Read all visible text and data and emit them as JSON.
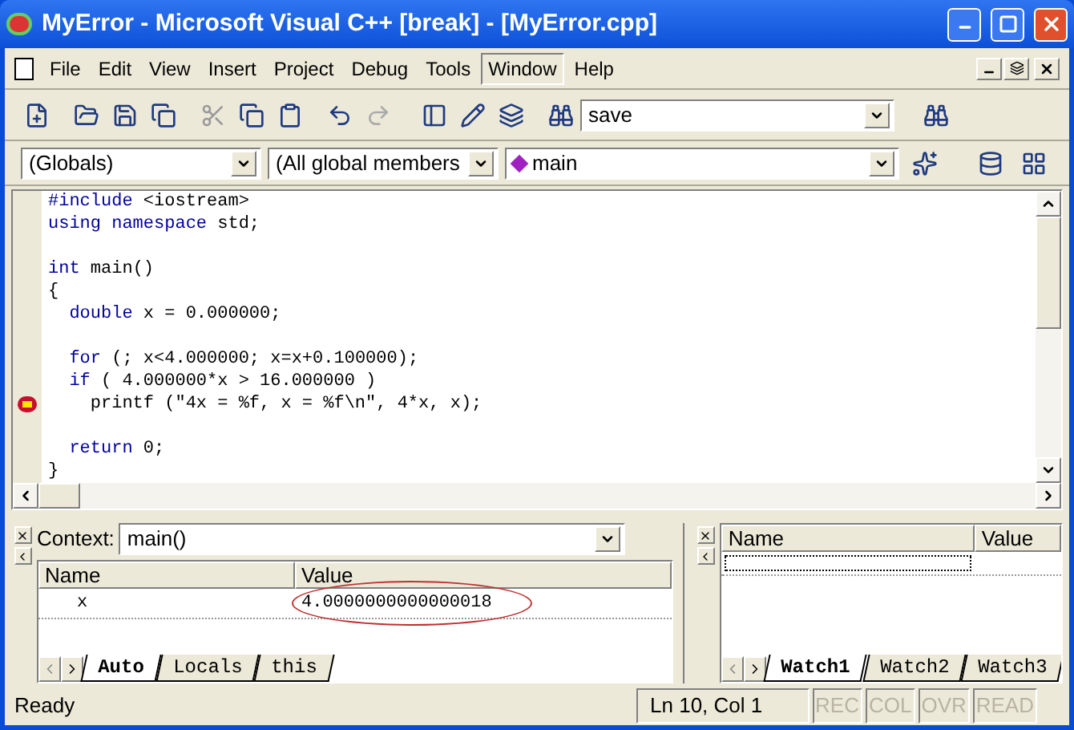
{
  "window": {
    "title": "MyError - Microsoft Visual C++ [break] - [MyError.cpp]"
  },
  "menu": [
    {
      "label": "File",
      "selected": false
    },
    {
      "label": "Edit",
      "selected": false
    },
    {
      "label": "View",
      "selected": false
    },
    {
      "label": "Insert",
      "selected": false
    },
    {
      "label": "Project",
      "selected": false
    },
    {
      "label": "Debug",
      "selected": false
    },
    {
      "label": "Tools",
      "selected": false
    },
    {
      "label": "Window",
      "selected": true
    },
    {
      "label": "Help",
      "selected": false
    }
  ],
  "find_combo": {
    "value": "save"
  },
  "wizard_bar": {
    "class_combo": "(Globals)",
    "filter_combo": "(All global members",
    "member_combo": "main"
  },
  "code": [
    {
      "current": false,
      "segments": [
        {
          "text": "#include",
          "kind": "keyword"
        },
        {
          "text": " <iostream>",
          "kind": "plain"
        }
      ]
    },
    {
      "current": false,
      "segments": [
        {
          "text": "using namespace",
          "kind": "keyword"
        },
        {
          "text": " std;",
          "kind": "plain"
        }
      ]
    },
    {
      "current": false
    },
    {
      "current": false,
      "segments": [
        {
          "text": "int",
          "kind": "keyword"
        },
        {
          "text": " main()",
          "kind": "plain"
        }
      ]
    },
    {
      "current": false,
      "segments": [
        {
          "text": "{",
          "kind": "plain"
        }
      ]
    },
    {
      "current": false,
      "segments": [
        {
          "text": "  double",
          "kind": "keyword"
        },
        {
          "text": " x = 0.000000;",
          "kind": "plain"
        }
      ]
    },
    {
      "current": false
    },
    {
      "current": false,
      "segments": [
        {
          "text": "  for",
          "kind": "keyword"
        },
        {
          "text": " (; x<4.000000; x=x+0.100000);",
          "kind": "plain"
        }
      ]
    },
    {
      "current": false,
      "segments": [
        {
          "text": "  if",
          "kind": "keyword"
        },
        {
          "text": " ( 4.000000*x > 16.000000 )",
          "kind": "plain"
        }
      ]
    },
    {
      "current": true,
      "segments": [
        {
          "text": "    printf (\"4x = %f, x = %f\\n\", 4*x, x);",
          "kind": "plain"
        }
      ]
    },
    {
      "current": false
    },
    {
      "current": false,
      "segments": [
        {
          "text": "  return",
          "kind": "keyword"
        },
        {
          "text": " 0;",
          "kind": "plain"
        }
      ]
    },
    {
      "current": false,
      "segments": [
        {
          "text": "}",
          "kind": "plain"
        }
      ]
    }
  ],
  "variables": {
    "context_label": "Context:",
    "context": "main()",
    "columns": [
      "Name",
      "Value"
    ],
    "rows": [
      {
        "name": "x",
        "value": "4.0000000000000018",
        "circled": true
      }
    ],
    "tabs": [
      {
        "label": "Auto",
        "selected": true
      },
      {
        "label": "Locals",
        "selected": false
      },
      {
        "label": "this",
        "selected": false
      }
    ]
  },
  "watch": {
    "columns": [
      "Name",
      "Value"
    ],
    "tabs": [
      {
        "label": "Watch1",
        "selected": true
      },
      {
        "label": "Watch2",
        "selected": false
      },
      {
        "label": "Watch3",
        "selected": false
      }
    ]
  },
  "status_bar": {
    "message": "Ready",
    "position": "Ln 10, Col 1",
    "indicators": [
      {
        "label": "REC",
        "disabled": true
      },
      {
        "label": "COL",
        "disabled": true
      },
      {
        "label": "OVR",
        "disabled": true
      },
      {
        "label": "READ",
        "disabled": true
      }
    ]
  }
}
